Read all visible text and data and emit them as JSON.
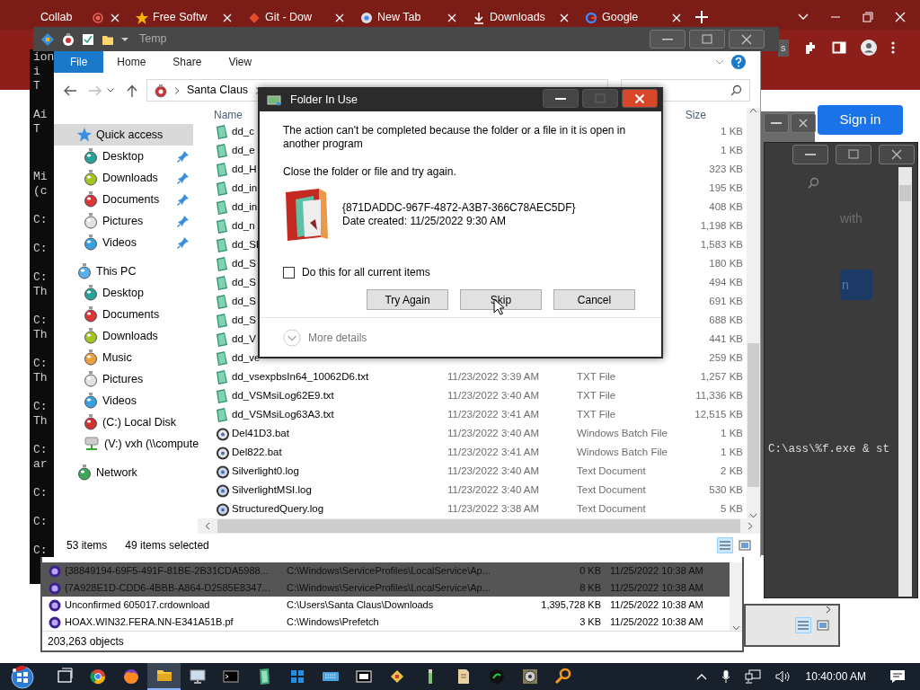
{
  "browser": {
    "tabs": [
      {
        "title": "Collab",
        "kind": "blank",
        "selected": false,
        "recording": true
      },
      {
        "title": "Free Softw",
        "kind": "star",
        "selected": false,
        "recording": false
      },
      {
        "title": "Git - Dow",
        "kind": "diamond",
        "selected": false,
        "recording": false
      },
      {
        "title": "New Tab",
        "kind": "ring",
        "selected": false,
        "recording": false
      },
      {
        "title": "Downloads",
        "kind": "download",
        "selected": false,
        "recording": false
      },
      {
        "title": "Google",
        "kind": "gring",
        "selected": false,
        "recording": false
      }
    ],
    "toolbar_label": "s",
    "sign_in": "Sign in"
  },
  "consoles": [
    {
      "blocks": [
        [
          "ion",
          "i",
          "T"
        ],
        [
          "Ai",
          "T"
        ]
      ]
    },
    {
      "blocks": [
        [
          "Mi",
          "(c"
        ],
        [
          "C:"
        ],
        [
          "C:"
        ],
        [
          "C:",
          "Th"
        ],
        [
          "C:",
          "Th"
        ],
        [
          "C:",
          "Th"
        ],
        [
          "C:",
          "Th"
        ],
        [
          "C:",
          "ar"
        ],
        [
          "C:"
        ],
        [
          "C:"
        ],
        [
          "C:"
        ]
      ]
    }
  ],
  "background_window": {
    "text": "with",
    "button": "n",
    "command": "C:\\ass\\%f.exe & st"
  },
  "explorer": {
    "title": "Temp",
    "ribbon_tabs": [
      {
        "label": "File",
        "selected": true
      },
      {
        "label": "Home",
        "selected": false
      },
      {
        "label": "Share",
        "selected": false
      },
      {
        "label": "View",
        "selected": false
      }
    ],
    "breadcrumb": [
      "Santa Claus"
    ],
    "nav": [
      {
        "label": "Quick access",
        "kind": "star",
        "selected": true,
        "children": [
          {
            "label": "Desktop",
            "kind": "desktop",
            "pinned": true,
            "selected": false
          },
          {
            "label": "Downloads",
            "kind": "downloads",
            "pinned": true,
            "selected": false
          },
          {
            "label": "Documents",
            "kind": "documents",
            "pinned": true,
            "selected": false
          },
          {
            "label": "Pictures",
            "kind": "pictures",
            "pinned": true,
            "selected": false
          },
          {
            "label": "Videos",
            "kind": "videos",
            "pinned": true,
            "selected": false
          }
        ]
      },
      {
        "label": "This PC",
        "kind": "pc",
        "selected": false,
        "children": [
          {
            "label": "Desktop",
            "kind": "desktop",
            "pinned": false,
            "selected": false
          },
          {
            "label": "Documents",
            "kind": "documents",
            "pinned": false,
            "selected": false
          },
          {
            "label": "Downloads",
            "kind": "downloads",
            "pinned": false,
            "selected": false
          },
          {
            "label": "Music",
            "kind": "music",
            "pinned": false,
            "selected": false
          },
          {
            "label": "Pictures",
            "kind": "pictures",
            "pinned": false,
            "selected": false
          },
          {
            "label": "Videos",
            "kind": "videos",
            "pinned": false,
            "selected": false
          },
          {
            "label": "(C:) Local Disk",
            "kind": "disk",
            "pinned": false,
            "selected": false
          },
          {
            "label": "(V:) vxh (\\\\compute",
            "kind": "netdrive",
            "pinned": false,
            "selected": false
          }
        ]
      },
      {
        "label": "Network",
        "kind": "network",
        "selected": false
      }
    ],
    "columns": [
      "Name",
      "Size"
    ],
    "rows": [
      {
        "name": "dd_c",
        "size": "1 KB",
        "kind": "txt"
      },
      {
        "name": "dd_e",
        "size": "1 KB",
        "kind": "txt"
      },
      {
        "name": "dd_H",
        "size": "323 KB",
        "kind": "txt"
      },
      {
        "name": "dd_in",
        "size": "195 KB",
        "kind": "txt"
      },
      {
        "name": "dd_in",
        "size": "408 KB",
        "kind": "txt"
      },
      {
        "name": "dd_n",
        "size": "1,198 KB",
        "kind": "txt"
      },
      {
        "name": "dd_SI",
        "size": "1,583 KB",
        "kind": "txt"
      },
      {
        "name": "dd_S",
        "size": "180 KB",
        "kind": "txt"
      },
      {
        "name": "dd_S",
        "size": "494 KB",
        "kind": "txt"
      },
      {
        "name": "dd_S",
        "size": "691 KB",
        "kind": "txt"
      },
      {
        "name": "dd_S",
        "size": "688 KB",
        "kind": "txt"
      },
      {
        "name": "dd_V",
        "size": "441 KB",
        "kind": "txt"
      },
      {
        "name": "dd_ve",
        "size": "259 KB",
        "kind": "txt"
      },
      {
        "name": "dd_vsexpbsIn64_10062D6.txt",
        "date": "11/23/2022 3:39 AM",
        "type": "TXT File",
        "size": "1,257 KB",
        "kind": "txt"
      },
      {
        "name": "dd_VSMsiLog62E9.txt",
        "date": "11/23/2022 3:40 AM",
        "type": "TXT File",
        "size": "11,336 KB",
        "kind": "txt"
      },
      {
        "name": "dd_VSMsiLog63A3.txt",
        "date": "11/23/2022 3:41 AM",
        "type": "TXT File",
        "size": "12,515 KB",
        "kind": "txt"
      },
      {
        "name": "Del41D3.bat",
        "date": "11/23/2022 3:40 AM",
        "type": "Windows Batch File",
        "size": "1 KB",
        "kind": "bat"
      },
      {
        "name": "Del822.bat",
        "date": "11/23/2022 3:41 AM",
        "type": "Windows Batch File",
        "size": "1 KB",
        "kind": "bat"
      },
      {
        "name": "Silverlight0.log",
        "date": "11/23/2022 3:40 AM",
        "type": "Text Document",
        "size": "2 KB",
        "kind": "log"
      },
      {
        "name": "SilverlightMSI.log",
        "date": "11/23/2022 3:40 AM",
        "type": "Text Document",
        "size": "530 KB",
        "kind": "log"
      },
      {
        "name": "StructuredQuery.log",
        "date": "11/23/2022 3:38 AM",
        "type": "Text Document",
        "size": "5 KB",
        "kind": "log"
      }
    ],
    "status": {
      "count": "53 items",
      "selection": "49 items selected"
    }
  },
  "dialog": {
    "title": "Folder In Use",
    "message": "The action can't be completed because the folder or a file in it is open in another program",
    "instruction": "Close the folder or file and try again.",
    "item_name": "{871DADDC-967F-4872-A3B7-366C78AEC5DF}",
    "item_date": "Date created: 11/25/2022 9:30 AM",
    "checkbox": {
      "label": "Do this for all current items",
      "checked": false
    },
    "buttons": [
      "Try Again",
      "Skip",
      "Cancel"
    ],
    "more_details": "More details"
  },
  "search_window": {
    "rows": [
      {
        "name": "{38849194-69F5-491F-81BE-2B31CDA5988...",
        "path": "C:\\Windows\\ServiceProfiles\\LocalService\\Ap...",
        "size": "0 KB",
        "modified": "11/25/2022 10:38 AM",
        "dimmed": true
      },
      {
        "name": "{7A928E1D-CDD6-4BBB-A864-D2585E8347...",
        "path": "C:\\Windows\\ServiceProfiles\\LocalService\\Ap...",
        "size": "8 KB",
        "modified": "11/25/2022 10:38 AM",
        "dimmed": true
      },
      {
        "name": "Unconfirmed 605017.crdownload",
        "path": "C:\\Users\\Santa Claus\\Downloads",
        "size": "1,395,728 KB",
        "modified": "11/25/2022 10:38 AM",
        "dimmed": false
      },
      {
        "name": "HOAX.WIN32.FERA.NN-E341A51B.pf",
        "path": "C:\\Windows\\Prefetch",
        "size": "3 KB",
        "modified": "11/25/2022 10:38 AM",
        "dimmed": false
      }
    ],
    "status": "203,263 objects"
  },
  "taskbar": {
    "apps": [
      {
        "kind": "taskview",
        "active": false
      },
      {
        "kind": "browser",
        "active": false
      },
      {
        "kind": "fox",
        "active": false
      },
      {
        "kind": "folder",
        "active": true
      },
      {
        "kind": "monitor",
        "active": false
      },
      {
        "kind": "terminal",
        "active": false
      },
      {
        "kind": "note",
        "active": false
      },
      {
        "kind": "grid",
        "active": false
      },
      {
        "kind": "keyboard",
        "active": false
      },
      {
        "kind": "archive",
        "active": false
      },
      {
        "kind": "diamond",
        "active": false
      },
      {
        "kind": "pen",
        "active": false
      },
      {
        "kind": "document",
        "active": false
      },
      {
        "kind": "circle",
        "active": false
      },
      {
        "kind": "disc",
        "active": false
      },
      {
        "kind": "search",
        "active": false
      }
    ],
    "clock": "10:40:00 AM"
  }
}
